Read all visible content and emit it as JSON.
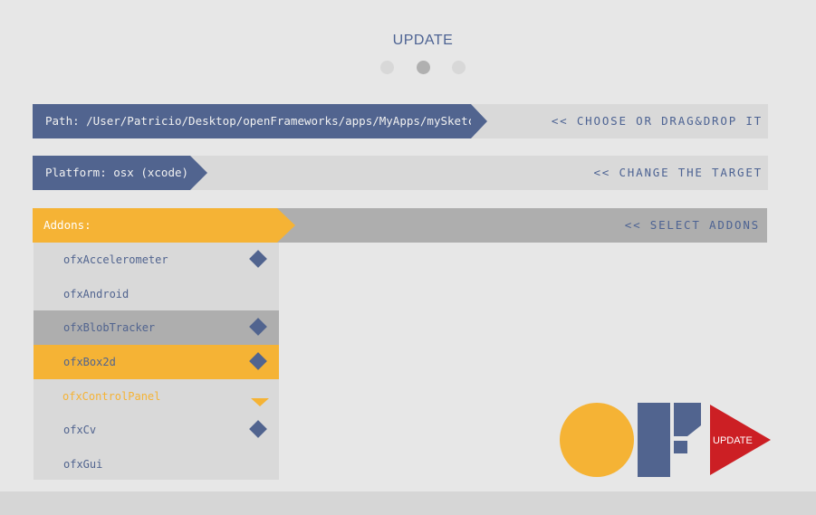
{
  "header": {
    "title": "UPDATE",
    "steps": [
      {
        "state": "inactive"
      },
      {
        "state": "active"
      },
      {
        "state": "inactive"
      }
    ]
  },
  "path": {
    "label": "Path: /User/Patricio/Desktop/openFrameworks/apps/MyApps/mySketch",
    "action": "<< CHOOSE OR DRAG&DROP IT"
  },
  "platform": {
    "label": "Platform: osx (xcode)",
    "action": "<< CHANGE THE TARGET"
  },
  "addons": {
    "label": "Addons:",
    "action": "<< SELECT ADDONS",
    "items": [
      {
        "name": "ofxAccelerometer",
        "selected": true,
        "state": "normal"
      },
      {
        "name": "ofxAndroid",
        "selected": false,
        "state": "normal"
      },
      {
        "name": "ofxBlobTracker",
        "selected": true,
        "state": "grey"
      },
      {
        "name": "ofxBox2d",
        "selected": true,
        "state": "orange"
      },
      {
        "name": "ofxControlPanel",
        "selected": false,
        "state": "hover",
        "marker": "triangle-down"
      },
      {
        "name": "ofxCv",
        "selected": true,
        "state": "normal"
      },
      {
        "name": "ofxGui",
        "selected": false,
        "state": "normal"
      }
    ]
  },
  "logo": {
    "button_label": "UPDATE"
  },
  "colors": {
    "accent_blue": "#51648f",
    "accent_orange": "#f5b335",
    "update_red": "#cc1f24",
    "background": "#e7e7e7"
  }
}
